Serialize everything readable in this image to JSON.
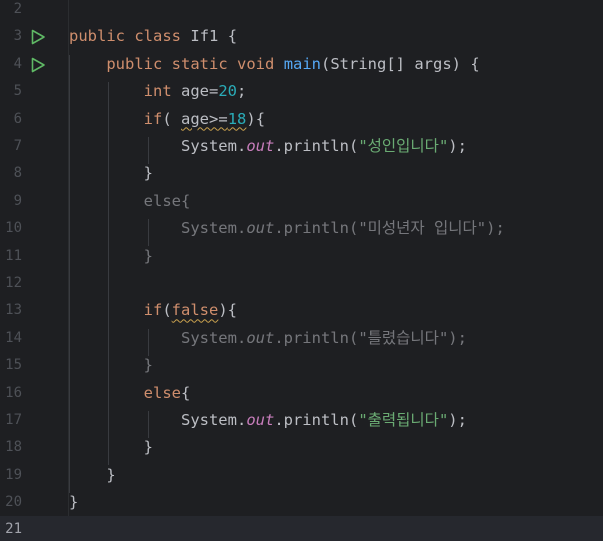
{
  "editor": {
    "line_numbers": [
      "2",
      "3",
      "4",
      "5",
      "6",
      "7",
      "8",
      "9",
      "10",
      "11",
      "12",
      "13",
      "14",
      "15",
      "16",
      "17",
      "18",
      "19",
      "20",
      "21"
    ],
    "current_line": "21",
    "colors": {
      "background": "#1e1f22",
      "keyword": "#cf8e6d",
      "method": "#56a8f5",
      "number": "#2aacb8",
      "string": "#6aab73",
      "field": "#c77dbb",
      "text": "#bcbec4",
      "run_icon": "#5fb865"
    },
    "run_icon_name": "run-gutter-icon",
    "code": {
      "l3": {
        "kw1": "public",
        "kw2": "class",
        "name": "If1",
        "brace": "{"
      },
      "l4": {
        "kw1": "public",
        "kw2": "static",
        "kw3": "void",
        "method": "main",
        "params": "(String[] args)",
        "brace": "{"
      },
      "l5": {
        "kw": "int",
        "var": "age",
        "op": "=",
        "num": "20",
        "end": ";"
      },
      "l6": {
        "kw": "if",
        "open": "(",
        "var": "age",
        "op": ">=",
        "num": "18",
        "close": "){"
      },
      "l7": {
        "obj": "System.",
        "field": "out",
        "call": ".println(",
        "str": "\"성인입니다\"",
        "end": ");"
      },
      "l8": {
        "brace": "}"
      },
      "l9": {
        "kw": "else",
        "brace": "{"
      },
      "l10": {
        "obj": "System.",
        "field": "out",
        "call": ".println(",
        "str": "\"미성년자 입니다\"",
        "end": ");"
      },
      "l11": {
        "brace": "}"
      },
      "l13": {
        "kw": "if",
        "open": "(",
        "bool": "false",
        "close": "){"
      },
      "l14": {
        "obj": "System.",
        "field": "out",
        "call": ".println(",
        "str": "\"틀렸습니다\"",
        "end": ");"
      },
      "l15": {
        "brace": "}"
      },
      "l16": {
        "kw": "else",
        "brace": "{"
      },
      "l17": {
        "obj": "System.",
        "field": "out",
        "call": ".println(",
        "str": "\"출력됩니다\"",
        "end": ");"
      },
      "l18": {
        "brace": "}"
      },
      "l19": {
        "brace": "}"
      },
      "l20": {
        "brace": "}"
      }
    }
  }
}
